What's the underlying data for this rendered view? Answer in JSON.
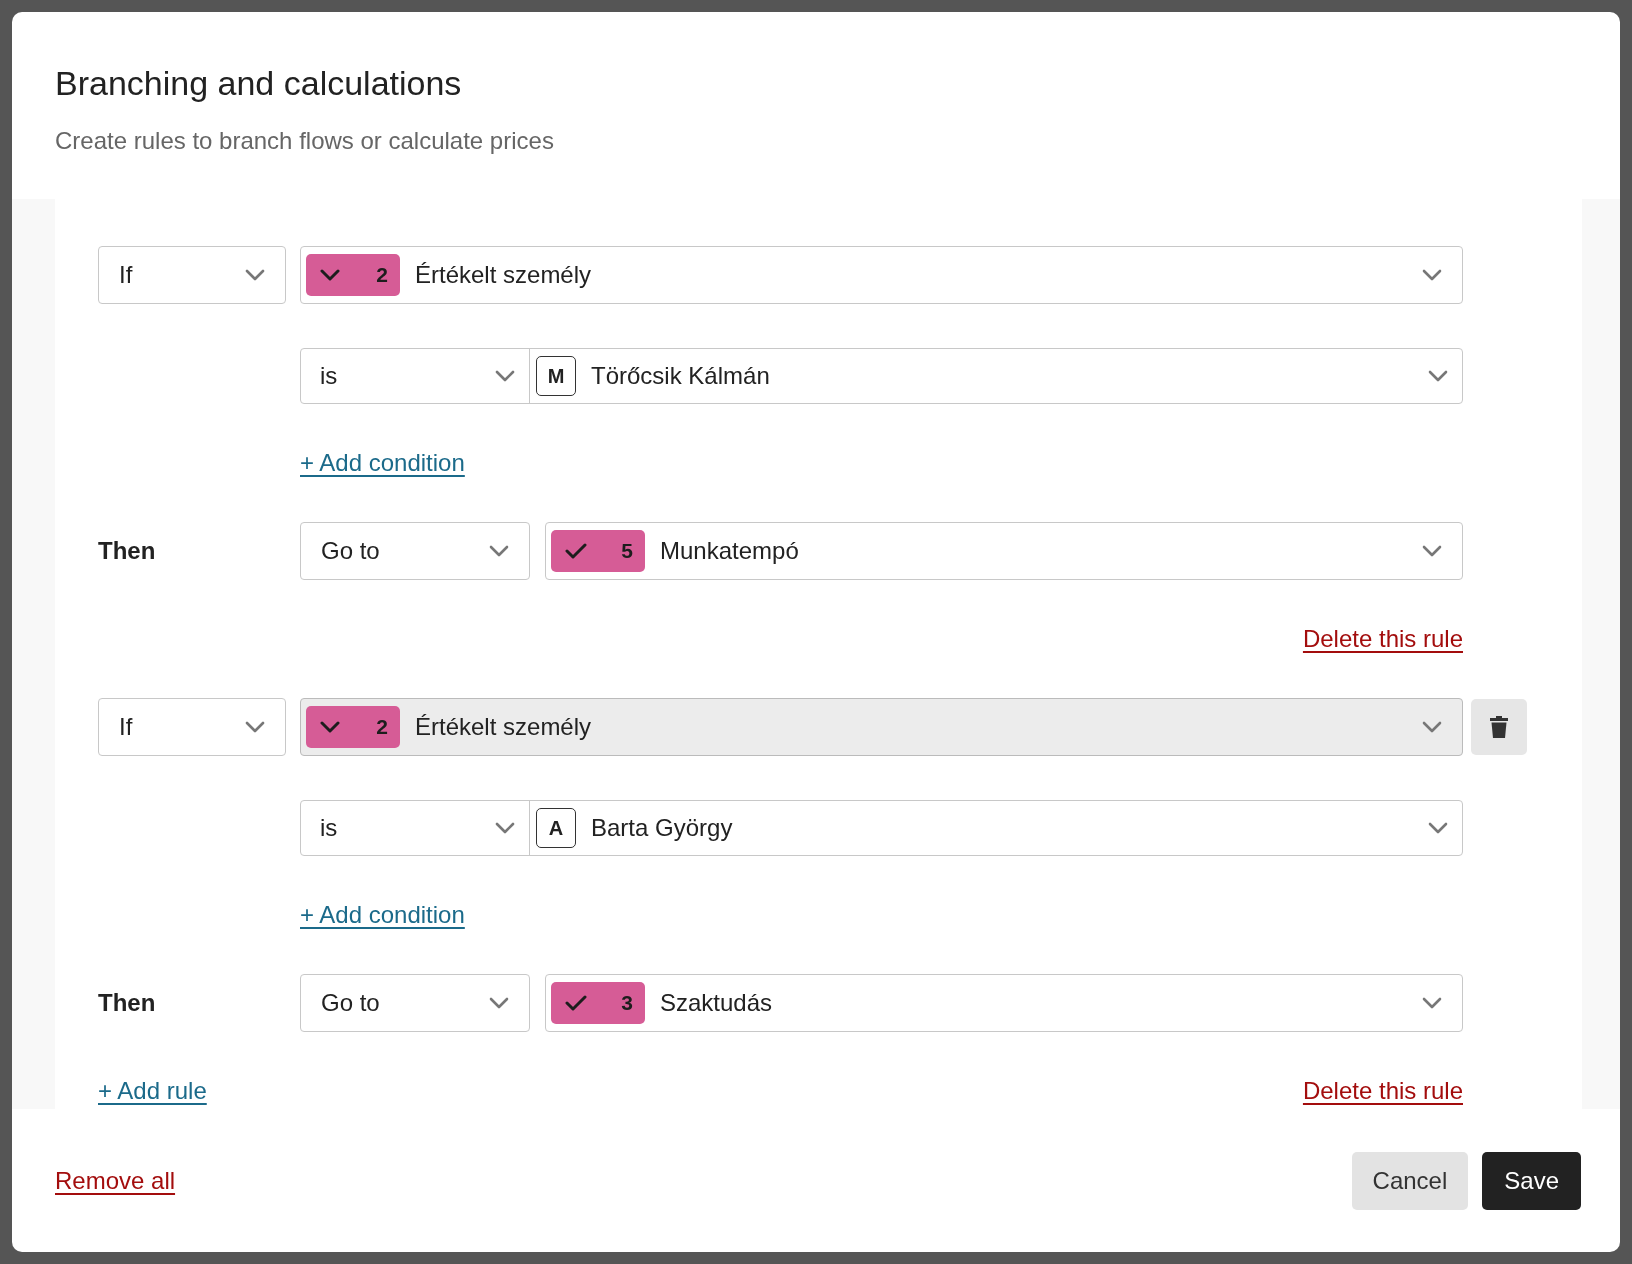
{
  "dialog": {
    "title": "Branching and calculations",
    "subtitle": "Create rules to branch flows or calculate prices"
  },
  "rules": [
    {
      "operator": "If",
      "hovered": false,
      "field": {
        "kind": "chevron",
        "number": "2",
        "label": "Értékelt személy"
      },
      "conditions": [
        {
          "operator": "is",
          "initial": "M",
          "value": "Törőcsik Kálmán"
        }
      ],
      "add_condition": "+ Add condition",
      "then_label": "Then",
      "action": "Go to",
      "target": {
        "kind": "check",
        "number": "5",
        "label": "Munkatempó"
      },
      "delete_link": "Delete this rule"
    },
    {
      "operator": "If",
      "hovered": true,
      "field": {
        "kind": "chevron",
        "number": "2",
        "label": "Értékelt személy"
      },
      "conditions": [
        {
          "operator": "is",
          "initial": "A",
          "value": "Barta György"
        }
      ],
      "add_condition": "+ Add condition",
      "then_label": "Then",
      "action": "Go to",
      "target": {
        "kind": "check",
        "number": "3",
        "label": "Szaktudás"
      },
      "delete_link": "Delete this rule"
    }
  ],
  "add_rule": "+ Add rule",
  "footer": {
    "remove_all": "Remove all",
    "cancel": "Cancel",
    "save": "Save"
  }
}
